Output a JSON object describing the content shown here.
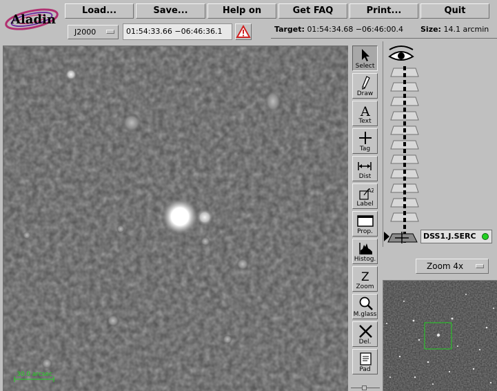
{
  "menu": {
    "load": "Load...",
    "save": "Save...",
    "help": "Help on",
    "faq": "Get FAQ",
    "print": "Print...",
    "quit": "Quit"
  },
  "logo_text": "Aladin",
  "coord": {
    "frame": "J2000",
    "value": "01:54:33.66 −06:46:36.1"
  },
  "target": {
    "label": "Target:",
    "value": "01:54:34.68 −06:46:00.4"
  },
  "size": {
    "label": "Size:",
    "value": "14.1 arcmin"
  },
  "tools": [
    {
      "label": "Select",
      "icon": "arrow-icon",
      "active": true
    },
    {
      "label": "Draw",
      "icon": "pencil-icon",
      "active": false
    },
    {
      "label": "Text",
      "icon": "text-icon",
      "active": false
    },
    {
      "label": "Tag",
      "icon": "cross-icon",
      "active": false
    },
    {
      "label": "Dist",
      "icon": "distance-icon",
      "active": false
    },
    {
      "label": "Label",
      "icon": "label-icon",
      "active": false
    },
    {
      "label": "Prop.",
      "icon": "window-icon",
      "active": false
    },
    {
      "label": "Histog.",
      "icon": "histogram-icon",
      "active": false
    },
    {
      "label": "Zoom",
      "icon": "zoom-z-icon",
      "active": false
    },
    {
      "label": "M.glass",
      "icon": "magnifier-icon",
      "active": false
    },
    {
      "label": "Del.",
      "icon": "delete-x-icon",
      "active": false
    },
    {
      "label": "Pad",
      "icon": "notepad-icon",
      "active": false
    }
  ],
  "stack": {
    "plane_name": "DSS1.J.SERC",
    "status_color": "#22d022"
  },
  "zoom": {
    "value": "Zoom 4x"
  },
  "scale_bar": {
    "label": "30.0 arcsec",
    "color": "#22d022"
  },
  "overview_box_color": "#22d022"
}
